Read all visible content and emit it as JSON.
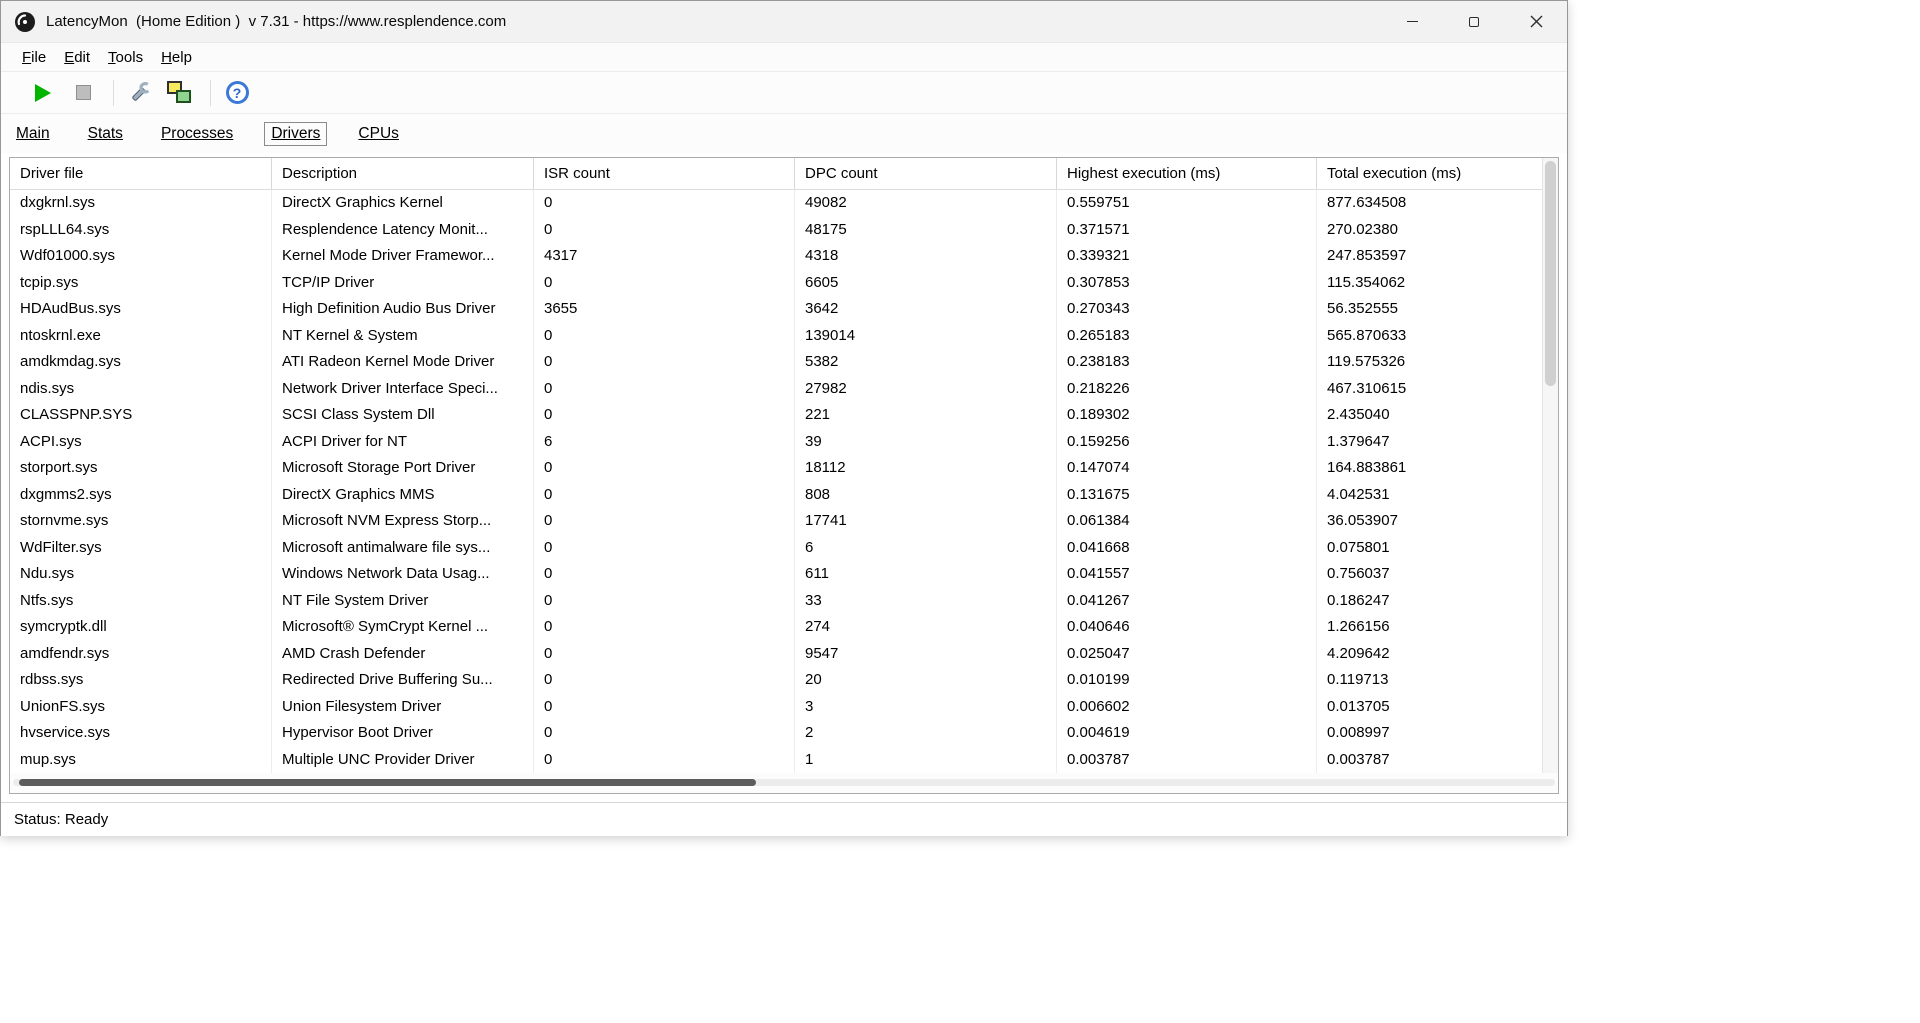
{
  "window": {
    "title": "LatencyMon  (Home Edition )  v 7.31 - https://www.resplendence.com"
  },
  "menu": {
    "items": [
      "File",
      "Edit",
      "Tools",
      "Help"
    ]
  },
  "toolbar": {
    "icons": [
      "play-icon",
      "stop-icon",
      "wrench-icon",
      "stacked-windows-icon",
      "help-icon"
    ],
    "help_glyph": "?"
  },
  "tabs": {
    "items": [
      "Main",
      "Stats",
      "Processes",
      "Drivers",
      "CPUs"
    ],
    "active": "Drivers"
  },
  "table": {
    "columns": [
      "Driver file",
      "Description",
      "ISR count",
      "DPC count",
      "Highest execution (ms)",
      "Total execution (ms)"
    ],
    "rows": [
      [
        "dxgkrnl.sys",
        "DirectX Graphics Kernel",
        "0",
        "49082",
        "0.559751",
        "877.634508"
      ],
      [
        "rspLLL64.sys",
        "Resplendence Latency Monit...",
        "0",
        "48175",
        "0.371571",
        "270.02380"
      ],
      [
        "Wdf01000.sys",
        "Kernel Mode Driver Framewor...",
        "4317",
        "4318",
        "0.339321",
        "247.853597"
      ],
      [
        "tcpip.sys",
        "TCP/IP Driver",
        "0",
        "6605",
        "0.307853",
        "115.354062"
      ],
      [
        "HDAudBus.sys",
        "High Definition Audio Bus Driver",
        "3655",
        "3642",
        "0.270343",
        "56.352555"
      ],
      [
        "ntoskrnl.exe",
        "NT Kernel & System",
        "0",
        "139014",
        "0.265183",
        "565.870633"
      ],
      [
        "amdkmdag.sys",
        "ATI Radeon Kernel Mode Driver",
        "0",
        "5382",
        "0.238183",
        "119.575326"
      ],
      [
        "ndis.sys",
        "Network Driver Interface Speci...",
        "0",
        "27982",
        "0.218226",
        "467.310615"
      ],
      [
        "CLASSPNP.SYS",
        "SCSI Class System Dll",
        "0",
        "221",
        "0.189302",
        "2.435040"
      ],
      [
        "ACPI.sys",
        "ACPI Driver for NT",
        "6",
        "39",
        "0.159256",
        "1.379647"
      ],
      [
        "storport.sys",
        "Microsoft Storage Port Driver",
        "0",
        "18112",
        "0.147074",
        "164.883861"
      ],
      [
        "dxgmms2.sys",
        "DirectX Graphics MMS",
        "0",
        "808",
        "0.131675",
        "4.042531"
      ],
      [
        "stornvme.sys",
        "Microsoft NVM Express Storp...",
        "0",
        "17741",
        "0.061384",
        "36.053907"
      ],
      [
        "WdFilter.sys",
        "Microsoft antimalware file sys...",
        "0",
        "6",
        "0.041668",
        "0.075801"
      ],
      [
        "Ndu.sys",
        "Windows Network Data Usag...",
        "0",
        "611",
        "0.041557",
        "0.756037"
      ],
      [
        "Ntfs.sys",
        "NT File System Driver",
        "0",
        "33",
        "0.041267",
        "0.186247"
      ],
      [
        "symcryptk.dll",
        "Microsoft® SymCrypt Kernel ...",
        "0",
        "274",
        "0.040646",
        "1.266156"
      ],
      [
        "amdfendr.sys",
        "AMD Crash Defender",
        "0",
        "9547",
        "0.025047",
        "4.209642"
      ],
      [
        "rdbss.sys",
        "Redirected Drive Buffering Su...",
        "0",
        "20",
        "0.010199",
        "0.119713"
      ],
      [
        "UnionFS.sys",
        "Union Filesystem Driver",
        "0",
        "3",
        "0.006602",
        "0.013705"
      ],
      [
        "hvservice.sys",
        "Hypervisor Boot Driver",
        "0",
        "2",
        "0.004619",
        "0.008997"
      ],
      [
        "mup.sys",
        "Multiple UNC Provider Driver",
        "0",
        "1",
        "0.003787",
        "0.003787"
      ]
    ]
  },
  "statusbar": {
    "text": "Status: Ready"
  }
}
